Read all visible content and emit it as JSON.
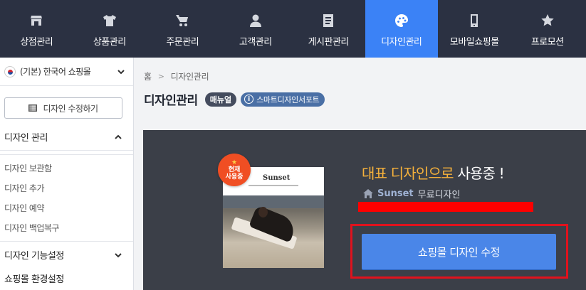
{
  "topnav": {
    "items": [
      {
        "label": "상점관리",
        "icon": "store-icon"
      },
      {
        "label": "상품관리",
        "icon": "shirt-icon"
      },
      {
        "label": "주문관리",
        "icon": "cart-icon"
      },
      {
        "label": "고객관리",
        "icon": "user-icon"
      },
      {
        "label": "게시판관리",
        "icon": "board-icon"
      },
      {
        "label": "디자인관리",
        "icon": "palette-icon",
        "active": true
      },
      {
        "label": "모바일쇼핑몰",
        "icon": "mobile-icon"
      },
      {
        "label": "프로모션",
        "icon": "star-icon"
      }
    ],
    "colors": {
      "background": "#2b3142",
      "active": "#3b82f6"
    }
  },
  "sidebar": {
    "language": "(기본) 한국어 쇼핑몰",
    "edit_button": "디자인 수정하기",
    "section_design": "디자인 관리",
    "design_links": [
      "디자인 보관함",
      "디자인 추가",
      "디자인 예약",
      "디자인 백업복구"
    ],
    "section_feature": "디자인 기능설정",
    "section_env": "쇼핑몰 환경설정"
  },
  "main": {
    "breadcrumb": {
      "home": "홈",
      "current": "디자인관리"
    },
    "title": "디자인관리",
    "manual_badge": "매뉴얼",
    "support_badge": "스마트디자인서포트",
    "panel": {
      "current_badge_line1": "현재",
      "current_badge_line2": "사용중",
      "thumb_logo": "Sunset",
      "headline_highlight": "대표 디자인으로",
      "headline_rest": " 사용중 !",
      "design_name": "Sunset",
      "design_type": "무료디자인",
      "primary_button": "쇼핑몰 디자인 수정"
    },
    "colors": {
      "panel": "#3b3f48",
      "highlight": "#f7b23b",
      "button": "#4a86e8",
      "annotation": "#e0121d"
    }
  }
}
